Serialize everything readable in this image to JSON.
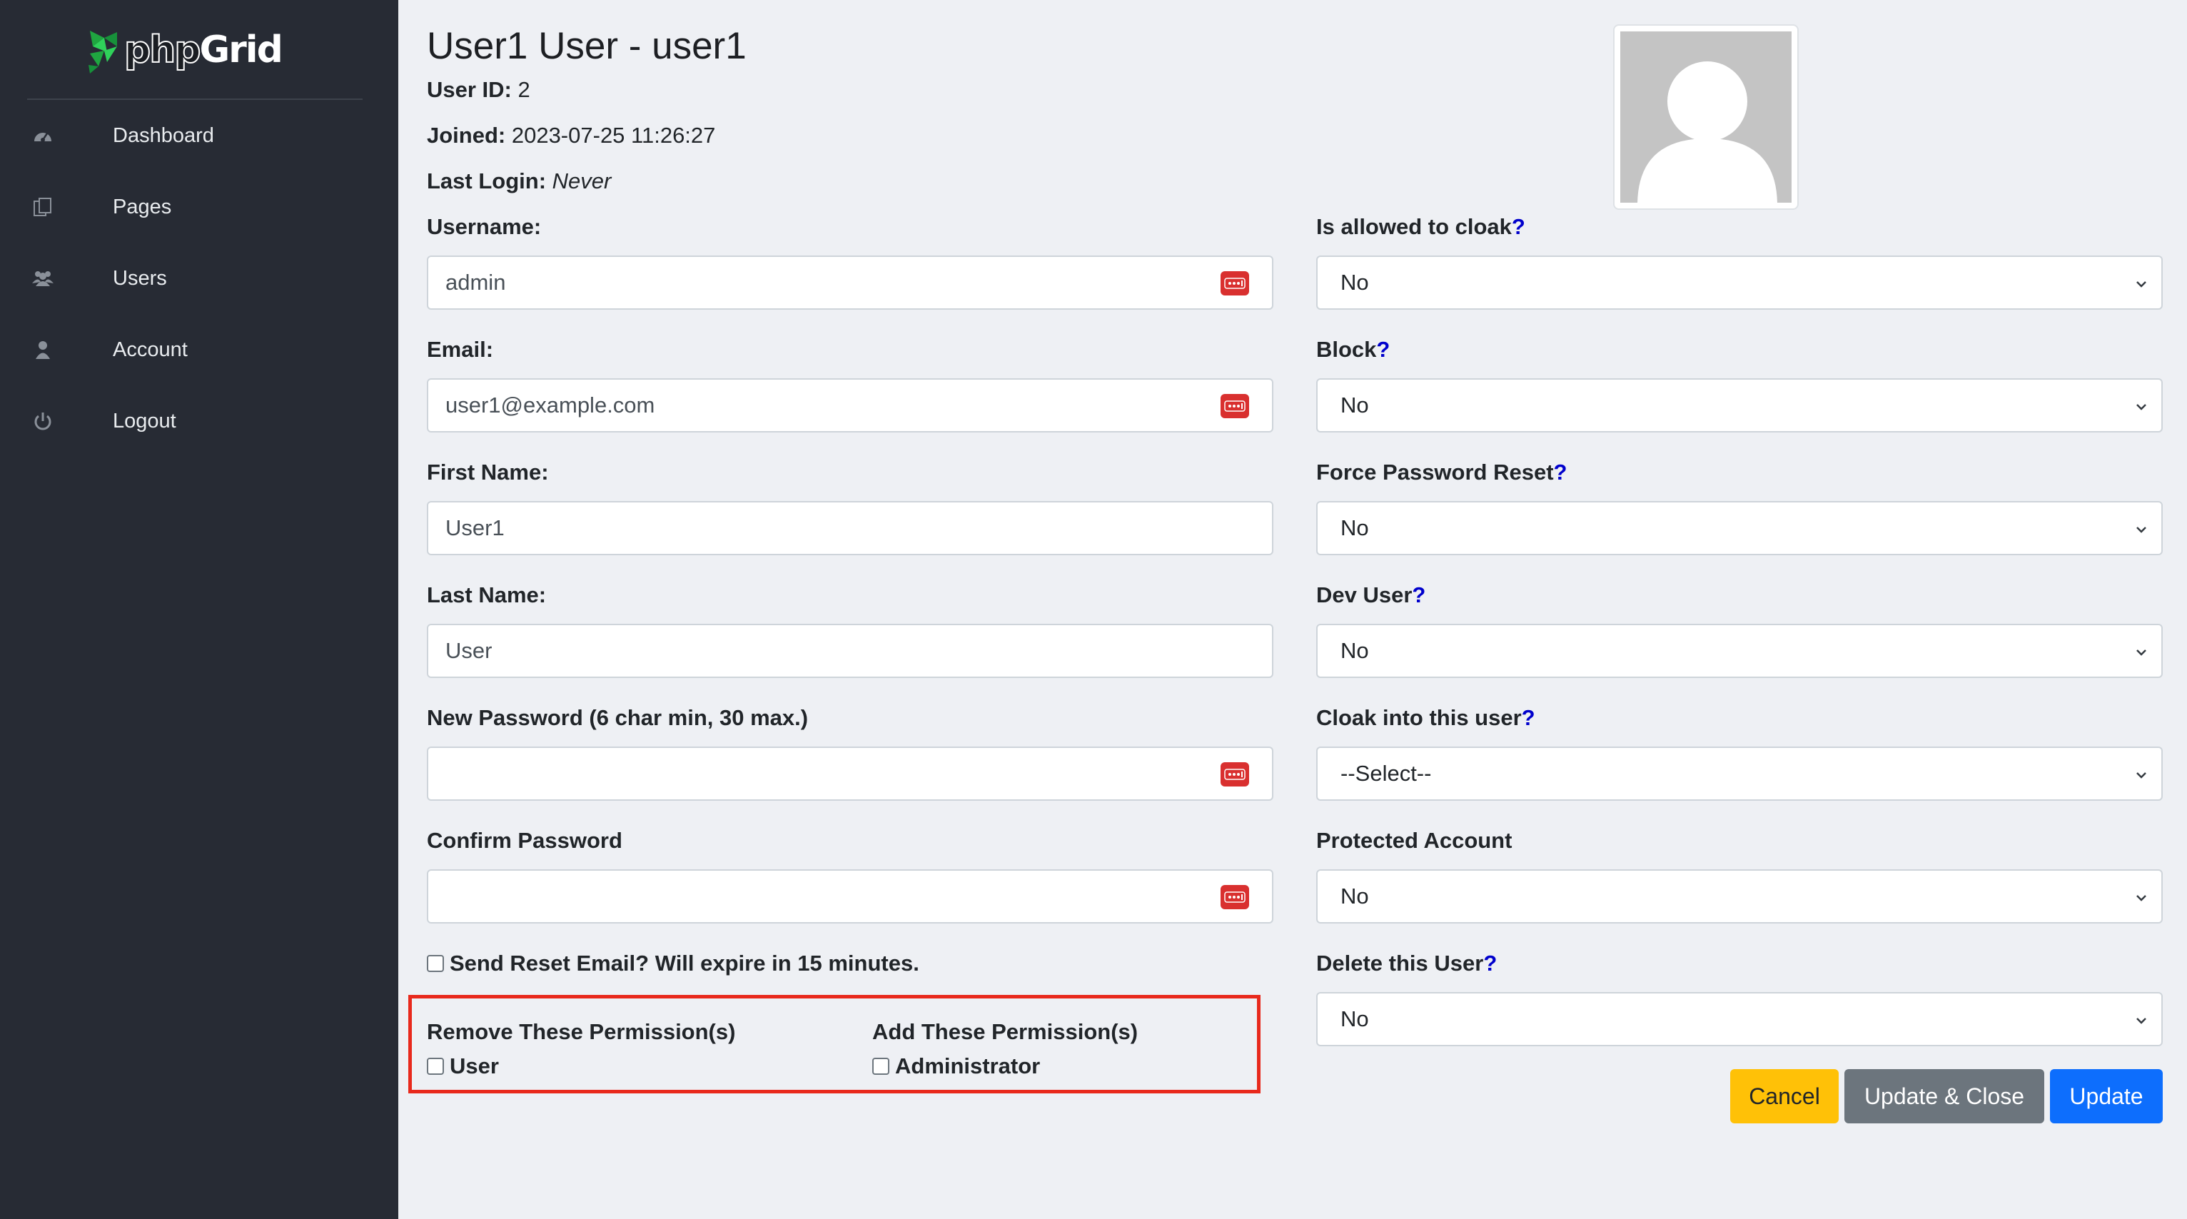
{
  "app": {
    "logo_text_a": "php",
    "logo_text_b": "Grid"
  },
  "sidebar": {
    "items": [
      {
        "label": "Dashboard",
        "icon": "dashboard-icon"
      },
      {
        "label": "Pages",
        "icon": "pages-icon"
      },
      {
        "label": "Users",
        "icon": "users-icon"
      },
      {
        "label": "Account",
        "icon": "account-icon"
      },
      {
        "label": "Logout",
        "icon": "power-icon"
      }
    ]
  },
  "user": {
    "title": "User1 User - user1",
    "id_label": "User ID:",
    "id_value": " 2",
    "joined_label": "Joined:",
    "joined_value": " 2023-07-25 11:26:27",
    "last_login_label": "Last Login:",
    "last_login_value": "Never"
  },
  "form": {
    "username_label": "Username:",
    "username_value": "admin",
    "email_label": "Email:",
    "email_value": "user1@example.com",
    "first_name_label": "First Name:",
    "first_name_value": "User1",
    "last_name_label": "Last Name:",
    "last_name_value": "User",
    "new_password_label": "New Password (6 char min, 30 max.)",
    "confirm_password_label": "Confirm Password",
    "reset_email_label": "Send Reset Email? Will expire in 15 minutes.",
    "remove_perms_label": "Remove These Permission(s)",
    "remove_perm_user": "User",
    "add_perms_label": "Add These Permission(s)",
    "add_perm_admin": "Administrator"
  },
  "settings": {
    "cloak_label": "Is allowed to cloak",
    "cloak_value": "No",
    "block_label": "Block",
    "block_value": "No",
    "force_reset_label": "Force Password Reset",
    "force_reset_value": "No",
    "dev_user_label": "Dev User",
    "dev_user_value": "No",
    "cloak_into_label": "Cloak into this user",
    "cloak_into_value": "--Select--",
    "protected_label": "Protected Account",
    "protected_value": "No",
    "delete_label": "Delete this User",
    "delete_value": "No",
    "help_mark": "?"
  },
  "actions": {
    "cancel": "Cancel",
    "update_close": "Update & Close",
    "update": "Update"
  },
  "colors": {
    "sidebar_bg": "#272b34",
    "cancel": "#ffc107",
    "update_close": "#6c757d",
    "update": "#0d6efd",
    "highlight": "#e8291c",
    "logo_green": "#27a745"
  }
}
